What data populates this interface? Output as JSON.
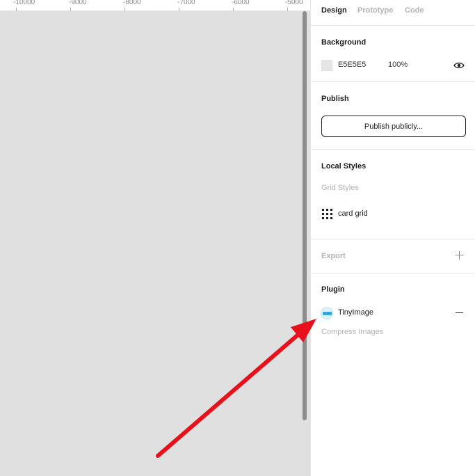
{
  "ruler": {
    "ticks": [
      "-10000",
      "-9000",
      "-8000",
      "-7000",
      "-6000",
      "-5000"
    ]
  },
  "panel": {
    "tabs": [
      "Design",
      "Prototype",
      "Code"
    ],
    "background": {
      "title": "Background",
      "hex": "E5E5E5",
      "opacity": "100%",
      "swatch_color": "#e5e5e5"
    },
    "publish": {
      "title": "Publish",
      "button": "Publish publicly..."
    },
    "local_styles": {
      "title": "Local Styles",
      "subheading": "Grid Styles",
      "items": [
        "card grid"
      ]
    },
    "export": {
      "title": "Export"
    },
    "plugin": {
      "title": "Plugin",
      "name": "TinyImage",
      "command": "Compress Images"
    }
  },
  "colors": {
    "accent_arrow": "#e8111b",
    "canvas": "#e0e0e0"
  }
}
